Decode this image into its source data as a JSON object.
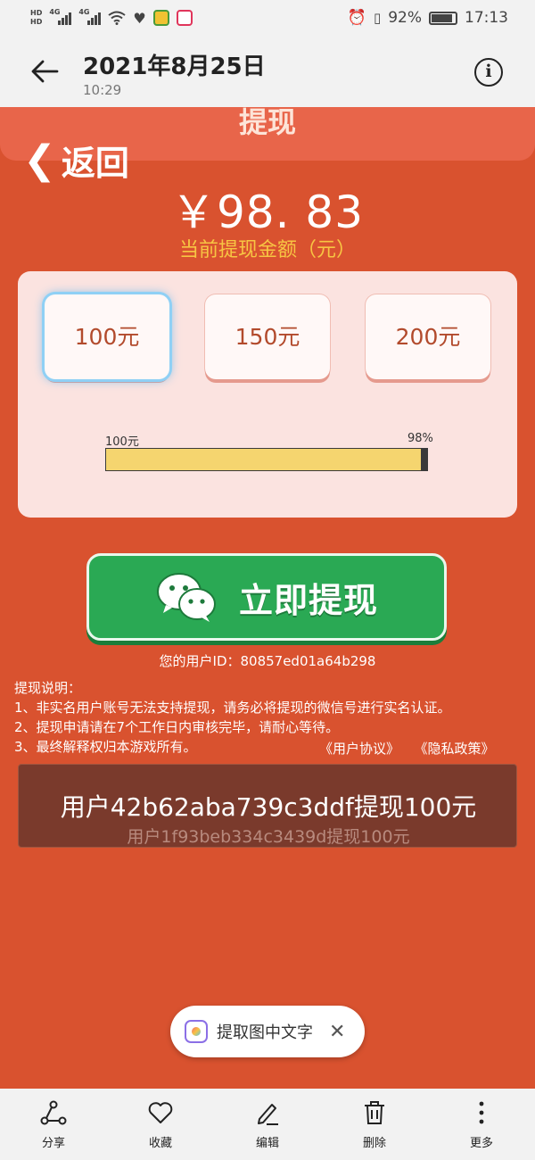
{
  "status_bar": {
    "battery": "92%",
    "time": "17:13",
    "network": "4G",
    "hd": "HD"
  },
  "viewer": {
    "date": "2021年8月25日",
    "time": "10:29"
  },
  "game": {
    "title": "提现",
    "back_label": "返回",
    "amount": "￥98. 83",
    "amount_label": "当前提现金额（元）",
    "options": [
      "100元",
      "150元",
      "200元"
    ],
    "selected_option": "100元",
    "progress": {
      "left_label": "100元",
      "right_label": "98%",
      "value_percent": 98
    },
    "withdraw_button": "立即提现",
    "user_id": "您的用户ID：80857ed01a64b298",
    "notes": {
      "title": "提现说明：",
      "items": [
        "1、非实名用户账号无法支持提现，请务必将提现的微信号进行实名认证。",
        "2、提现申请请在7个工作日内审核完毕，请耐心等待。",
        "3、最终解释权归本游戏所有。"
      ],
      "agreement_link": "《用户协议》",
      "privacy_link": "《隐私政策》"
    },
    "ticker": {
      "line1": "用户42b62aba739c3ddf提现100元",
      "line2": "用户1f93beb334c3439d提现100元"
    }
  },
  "ocr_pill": {
    "label": "提取图中文字"
  },
  "toolbar": {
    "items": [
      {
        "label": "分享",
        "icon": "share-icon"
      },
      {
        "label": "收藏",
        "icon": "heart-icon"
      },
      {
        "label": "编辑",
        "icon": "edit-icon"
      },
      {
        "label": "删除",
        "icon": "trash-icon"
      },
      {
        "label": "更多",
        "icon": "more-icon"
      }
    ]
  },
  "colors": {
    "background": "#d9522f",
    "accent_yellow": "#f7c543",
    "button_green": "#2aa954",
    "progress_fill": "#f5d56f"
  }
}
